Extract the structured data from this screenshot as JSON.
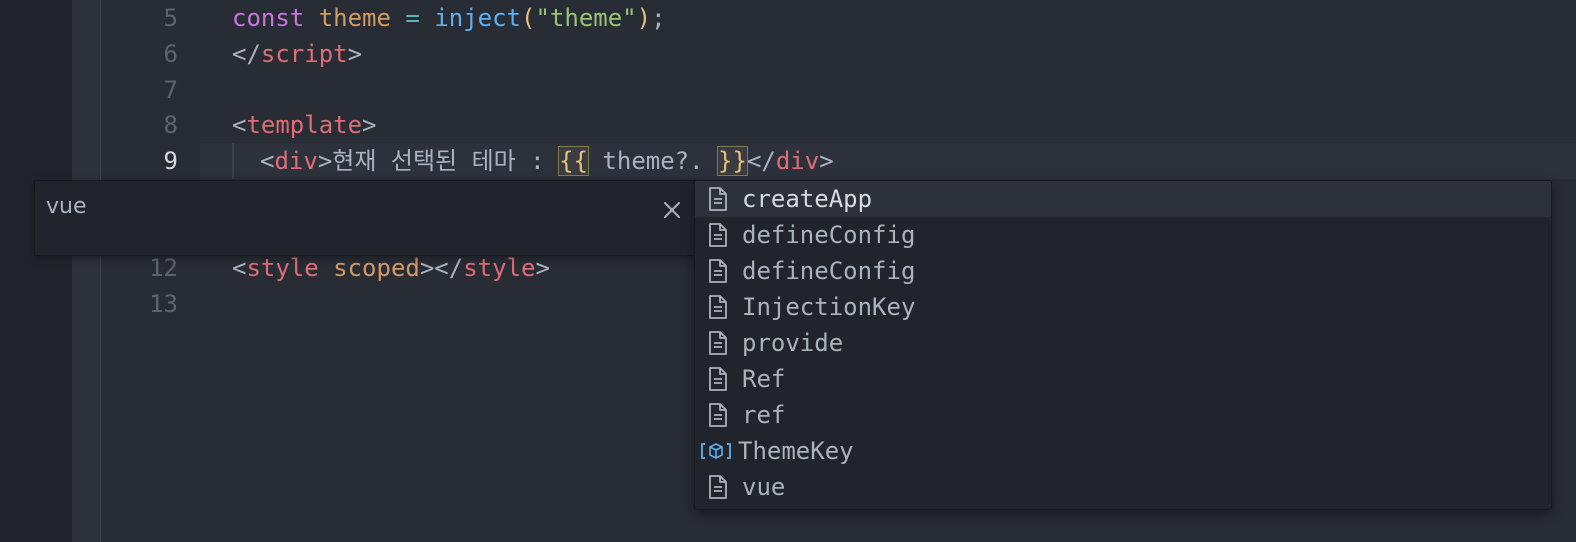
{
  "editor": {
    "line_numbers": [
      "5",
      "6",
      "7",
      "8",
      "9",
      "12",
      "13"
    ],
    "lines": {
      "l5": [
        "const",
        " ",
        "theme",
        " ",
        "=",
        " ",
        "inject",
        "(",
        "\"theme\"",
        ")",
        ";"
      ],
      "l6": [
        "</",
        "script",
        ">"
      ],
      "l8": [
        "<",
        "template",
        ">"
      ],
      "l9": [
        "<",
        "div",
        ">",
        "현재 선택된 테마 : ",
        "{{",
        " theme?. ",
        "}}",
        "</",
        "div",
        ">"
      ],
      "l12": [
        "<",
        "style",
        " ",
        "scoped",
        "></",
        "style",
        ">"
      ]
    },
    "current_line": "9"
  },
  "hover_tooltip": {
    "text": "vue",
    "close_icon": "close-icon"
  },
  "suggest": {
    "items": [
      {
        "label": "createApp",
        "icon": "file-icon",
        "selected": true
      },
      {
        "label": "defineConfig",
        "icon": "file-icon"
      },
      {
        "label": "defineConfig",
        "icon": "file-icon"
      },
      {
        "label": "InjectionKey",
        "icon": "file-icon"
      },
      {
        "label": "provide",
        "icon": "file-icon"
      },
      {
        "label": "Ref",
        "icon": "file-icon"
      },
      {
        "label": "ref",
        "icon": "file-icon"
      },
      {
        "label": "ThemeKey",
        "icon": "variable-icon"
      },
      {
        "label": "vue",
        "icon": "file-icon"
      }
    ]
  },
  "colors": {
    "background": "#282c34",
    "keyword": "#c678dd",
    "variable": "#e5c07b",
    "function": "#61afef",
    "string": "#98c379",
    "tag": "#e06c75",
    "attribute": "#d19a66",
    "variable_icon": "#61afef"
  }
}
